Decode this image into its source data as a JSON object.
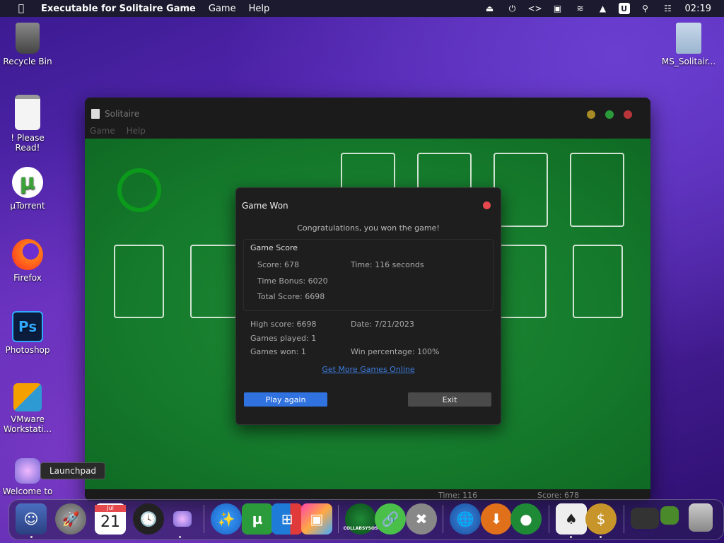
{
  "menubar": {
    "app_name": "Executable for Solitaire Game",
    "items": [
      "Game",
      "Help"
    ],
    "u_badge": "U",
    "clock": "02:19"
  },
  "desktop": {
    "icons": [
      {
        "label": "Recycle Bin"
      },
      {
        "label": "! Please Read!"
      },
      {
        "label": "µTorrent"
      },
      {
        "label": "Firefox"
      },
      {
        "label": "Photoshop"
      },
      {
        "label": "VMware Workstati..."
      },
      {
        "label": "Welcome to"
      },
      {
        "label": "MS_Solitair..."
      }
    ]
  },
  "window": {
    "title": "Solitaire",
    "menu": [
      "Game",
      "Help"
    ],
    "status_time": "Time: 116",
    "status_score": "Score: 678"
  },
  "dialog": {
    "title": "Game Won",
    "congrats": "Congratulations, you won the game!",
    "score_header": "Game Score",
    "score": "Score: 678",
    "time": "Time:  116 seconds",
    "time_bonus": "Time Bonus: 6020",
    "total_score": "Total Score: 6698",
    "high_score": "High score: 6698",
    "date": "Date: 7/21/2023",
    "games_played": "Games played: 1",
    "games_won": "Games won: 1",
    "win_percentage": "Win percentage: 100%",
    "link": "Get More Games Online",
    "play_again": "Play again",
    "exit": "Exit"
  },
  "tooltip": "Launchpad",
  "dock": {
    "calendar_month": "Jul",
    "calendar_day": "21",
    "collab_label": "COLLABSYSOS"
  },
  "colors": {
    "felt": "#157a2c",
    "accent_blue": "#2f72e0",
    "close_red": "#e5484d"
  }
}
